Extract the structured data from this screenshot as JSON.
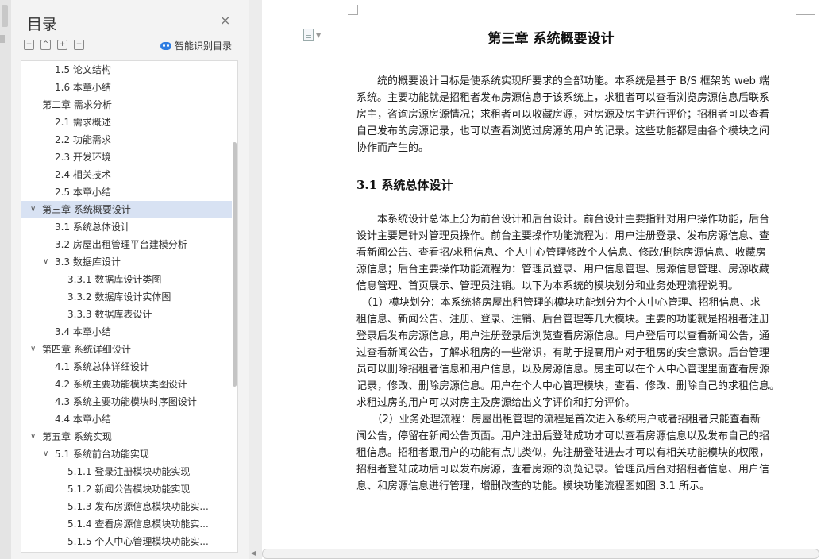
{
  "toc": {
    "title": "目录",
    "close_icon": "×",
    "tool_collapse_all": "−",
    "tool_expand": "^",
    "tool_add": "+",
    "tool_remove": "−",
    "smart_label": "智能识别目录",
    "items": [
      {
        "label": "1.5 论文结构",
        "level": 2,
        "arrow": ""
      },
      {
        "label": "1.6 本章小结",
        "level": 2,
        "arrow": ""
      },
      {
        "label": "第二章 需求分析",
        "level": 1,
        "arrow": ""
      },
      {
        "label": "2.1 需求概述",
        "level": 2,
        "arrow": ""
      },
      {
        "label": "2.2 功能需求",
        "level": 2,
        "arrow": ""
      },
      {
        "label": "2.3 开发环境",
        "level": 2,
        "arrow": ""
      },
      {
        "label": "2.4 相关技术",
        "level": 2,
        "arrow": ""
      },
      {
        "label": "2.5 本章小结",
        "level": 2,
        "arrow": ""
      },
      {
        "label": "第三章 系统概要设计",
        "level": 1,
        "arrow": "∨",
        "selected": true
      },
      {
        "label": "3.1 系统总体设计",
        "level": 2,
        "arrow": ""
      },
      {
        "label": "3.2 房屋出租管理平台建模分析",
        "level": 2,
        "arrow": ""
      },
      {
        "label": "3.3 数据库设计",
        "level": 2,
        "arrow": "∨"
      },
      {
        "label": "3.3.1 数据库设计类图",
        "level": 3,
        "arrow": ""
      },
      {
        "label": "3.3.2 数据库设计实体图",
        "level": 3,
        "arrow": ""
      },
      {
        "label": "3.3.3 数据库表设计",
        "level": 3,
        "arrow": ""
      },
      {
        "label": "3.4 本章小结",
        "level": 2,
        "arrow": ""
      },
      {
        "label": "第四章 系统详细设计",
        "level": 1,
        "arrow": "∨"
      },
      {
        "label": "4.1 系统总体详细设计",
        "level": 2,
        "arrow": ""
      },
      {
        "label": "4.2 系统主要功能模块类图设计",
        "level": 2,
        "arrow": ""
      },
      {
        "label": "4.3 系统主要功能模块时序图设计",
        "level": 2,
        "arrow": ""
      },
      {
        "label": "4.4 本章小结",
        "level": 2,
        "arrow": ""
      },
      {
        "label": "第五章 系统实现",
        "level": 1,
        "arrow": "∨"
      },
      {
        "label": "5.1 系统前台功能实现",
        "level": 2,
        "arrow": "∨"
      },
      {
        "label": "5.1.1 登录注册模块功能实现",
        "level": 3,
        "arrow": ""
      },
      {
        "label": "5.1.2 新闻公告模块功能实现",
        "level": 3,
        "arrow": ""
      },
      {
        "label": "5.1.3 发布房源信息模块功能实...",
        "level": 3,
        "arrow": ""
      },
      {
        "label": "5.1.4 查看房源信息模块功能实...",
        "level": 3,
        "arrow": ""
      },
      {
        "label": "5.1.5 个人中心管理模块功能实...",
        "level": 3,
        "arrow": ""
      }
    ]
  },
  "doc": {
    "chapter_title": "第三章 系统概要设计",
    "section_title": "3.1 系统总体设计",
    "para1": [
      "　　统的概要设计目标是使系统实现所要求的全部功能。本系统是基于 B/S 框架的 web 端",
      "系统。主要功能就是招租者发布房源信息于该系统上，求租者可以查看浏览房源信息后联系",
      "房主，咨询房源房源情况；求租者可以收藏房源，对房源及房主进行评价；招租者可以查看",
      "自己发布的房源记录，也可以查看浏览过房源的用户的记录。这些功能都是由各个模块之间",
      "协作而产生的。"
    ],
    "para2": [
      "　　本系统设计总体上分为前台设计和后台设计。前台设计主要指针对用户操作功能，后台",
      "设计主要是针对管理员操作。前台主要操作功能流程为：用户注册登录、发布房源信息、查",
      "看新闻公告、查看招/求租信息、个人中心管理修改个人信息、修改/删除房源信息、收藏房",
      "源信息；后台主要操作功能流程为：管理员登录、用户信息管理、房源信息管理、房源收藏",
      "信息管理、首页展示、管理员注销。以下为本系统的模块划分和业务处理流程说明。",
      "　（1）模块划分：本系统将房屋出租管理的模块功能划分为个人中心管理、招租信息、求",
      "租信息、新闻公告、注册、登录、注销、后台管理等几大模块。主要的功能就是招租者注册",
      "登录后发布房源信息，用户注册登录后浏览查看房源信息。用户登后可以查看新闻公告，通",
      "过查看新闻公告，了解求租房的一些常识，有助于提高用户对于租房的安全意识。后台管理",
      "员可以删除招租者信息和用户信息，以及房源信息。房主可以在个人中心管理里面查看房源",
      "记录，修改、删除房源信息。用户在个人中心管理模块，查看、修改、删除自己的求租信息。",
      "求租过房的用户可以对房主及房源给出文字评价和打分评价。",
      "　　（2）业务处理流程：房屋出租管理的流程是首次进入系统用户或者招租者只能查看新",
      "闻公告，停留在新闻公告页面。用户注册后登陆成功才可以查看房源信息以及发布自己的招",
      "租信息。招租者跟用户的功能有点儿类似，先注册登陆进去才可以有相关功能模块的权限，",
      "招租者登陆成功后可以发布房源，查看房源的浏览记录。管理员后台对招租者信息、用户信",
      "息、和房源信息进行管理，增删改查的功能。模块功能流程图如图 3.1 所示。"
    ]
  }
}
